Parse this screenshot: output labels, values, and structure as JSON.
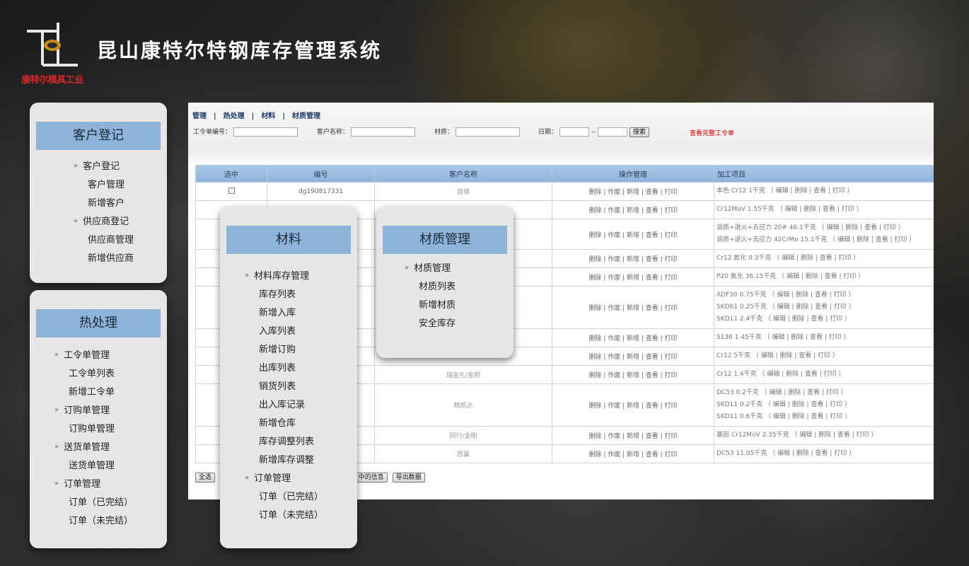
{
  "app": {
    "title": "昆山康特尔特钢库存管理系统",
    "logo_text": "康特尔模具工业"
  },
  "panels": {
    "customer": {
      "title": "客户登记",
      "items": [
        {
          "label": "客户登记",
          "group": true
        },
        {
          "label": "客户管理",
          "group": false
        },
        {
          "label": "新增客户",
          "group": false
        },
        {
          "label": "供应商登记",
          "group": true
        },
        {
          "label": "供应商管理",
          "group": false
        },
        {
          "label": "新增供应商",
          "group": false
        }
      ]
    },
    "heat": {
      "title": "热处理",
      "items": [
        {
          "label": "工令单管理",
          "group": true
        },
        {
          "label": "工令单列表",
          "group": false
        },
        {
          "label": "新增工令单",
          "group": false
        },
        {
          "label": "订购单管理",
          "group": true
        },
        {
          "label": "订购单管理",
          "group": false
        },
        {
          "label": "送货单管理",
          "group": true
        },
        {
          "label": "送货单管理",
          "group": false
        },
        {
          "label": "订单管理",
          "group": true
        },
        {
          "label": "订单（已完结）",
          "group": false
        },
        {
          "label": "订单（未完结）",
          "group": false
        }
      ]
    },
    "material": {
      "title": "材料",
      "items": [
        {
          "label": "材料库存管理",
          "group": true
        },
        {
          "label": "库存列表",
          "group": false
        },
        {
          "label": "新增入库",
          "group": false
        },
        {
          "label": "入库列表",
          "group": false
        },
        {
          "label": "新增订购",
          "group": false
        },
        {
          "label": "出库列表",
          "group": false
        },
        {
          "label": "销货列表",
          "group": false
        },
        {
          "label": "出入库记录",
          "group": false
        },
        {
          "label": "新增仓库",
          "group": false
        },
        {
          "label": "库存调整列表",
          "group": false
        },
        {
          "label": "新增库存调整",
          "group": false
        },
        {
          "label": "订单管理",
          "group": true
        },
        {
          "label": "订单（已完结）",
          "group": false
        },
        {
          "label": "订单（未完结）",
          "group": false
        }
      ]
    },
    "matmgmt": {
      "title": "材质管理",
      "items": [
        {
          "label": "材质管理",
          "group": true
        },
        {
          "label": "材质列表",
          "group": false
        },
        {
          "label": "新增材质",
          "group": false
        },
        {
          "label": "安全库存",
          "group": false
        }
      ]
    }
  },
  "main": {
    "nav": [
      "管理",
      "热处理",
      "材料",
      "材质管理"
    ],
    "filter": {
      "order_no_label": "工令单编号：",
      "customer_label": "客户名称：",
      "material_label": "材质：",
      "date_label": "日期：",
      "date_sep": "--",
      "search_button": "搜索",
      "full_link": "查看完整工令单"
    },
    "table": {
      "headers": [
        "选中",
        "编号",
        "客户名称",
        "操作管理",
        "加工项目"
      ],
      "ops": "删除 | 作废 | 新增 | 查看 | 打印",
      "rows": [
        {
          "id": "dg190817331",
          "customer": "苗德",
          "proc": [
            "本色 Cr12 1千克 （ 编辑 | 删除 | 查看 | 打印 ）"
          ]
        },
        {
          "id": "",
          "customer": "",
          "proc": [
            "Cr12MoV 1.55千克 （ 编辑 | 删除 | 查看 | 打印 ）"
          ]
        },
        {
          "id": "",
          "customer": "",
          "proc": [
            "调质+退火+去应力 20# 46.1千克 （ 编辑 | 删除 | 查看 | 打印 ）",
            "调质+退火+去应力 42CrMo 15.1千克 （ 编辑 | 删除 | 查看 | 打印 ）"
          ]
        },
        {
          "id": "",
          "customer": "",
          "proc": [
            "Cr12 氮化 0.3千克 （ 编辑 | 删除 | 查看 | 打印 ）"
          ]
        },
        {
          "id": "",
          "customer": "",
          "proc": [
            "P20 氮化 36.15千克 （ 编辑 | 删除 | 查看 | 打印 ）"
          ]
        },
        {
          "id": "",
          "customer": "",
          "proc": [
            "ADF30 0.75千克 （ 编辑 | 删除 | 查看 | 打印 ）",
            "SKD61 0.25千克 （ 编辑 | 删除 | 查看 | 打印 ）",
            "SKD11 2.4千克 （ 编辑 | 删除 | 查看 | 打印 ）"
          ]
        },
        {
          "id": "",
          "customer": "",
          "proc": [
            "S136 1.45千克 （ 编辑 | 删除 | 查看 | 打印 ）"
          ]
        },
        {
          "id": "",
          "customer": "",
          "proc": [
            "Cr12 5千克 （ 编辑 | 删除 | 查看 | 打印 ）"
          ]
        },
        {
          "id": "",
          "customer": "瑞金孔/金刚",
          "proc": [
            "Cr12 1.4千克 （ 编辑 | 删除 | 查看 | 打印 ）"
          ]
        },
        {
          "id": "",
          "customer": "精凯达",
          "proc": [
            "DC53 0.2千克 （ 编辑 | 删除 | 查看 | 打印 ）",
            "SKD11 0.2千克 （ 编辑 | 删除 | 查看 | 打印 ）",
            "SKD11 0.6千克 （ 编辑 | 删除 | 查看 | 打印 ）"
          ]
        },
        {
          "id": "",
          "customer": "同行/金刚",
          "proc": [
            "基因 Cr12MoV 2.35千克 （ 编辑 | 删除 | 查看 | 打印 ）"
          ]
        },
        {
          "id": "",
          "customer": "思翼",
          "proc": [
            "DC53 11.05千克 （ 编辑 | 删除 | 查看 | 打印 ）"
          ]
        }
      ]
    },
    "bottom": {
      "select_all": "全选",
      "selected_info": "中的信息",
      "export": "导出数据"
    }
  }
}
